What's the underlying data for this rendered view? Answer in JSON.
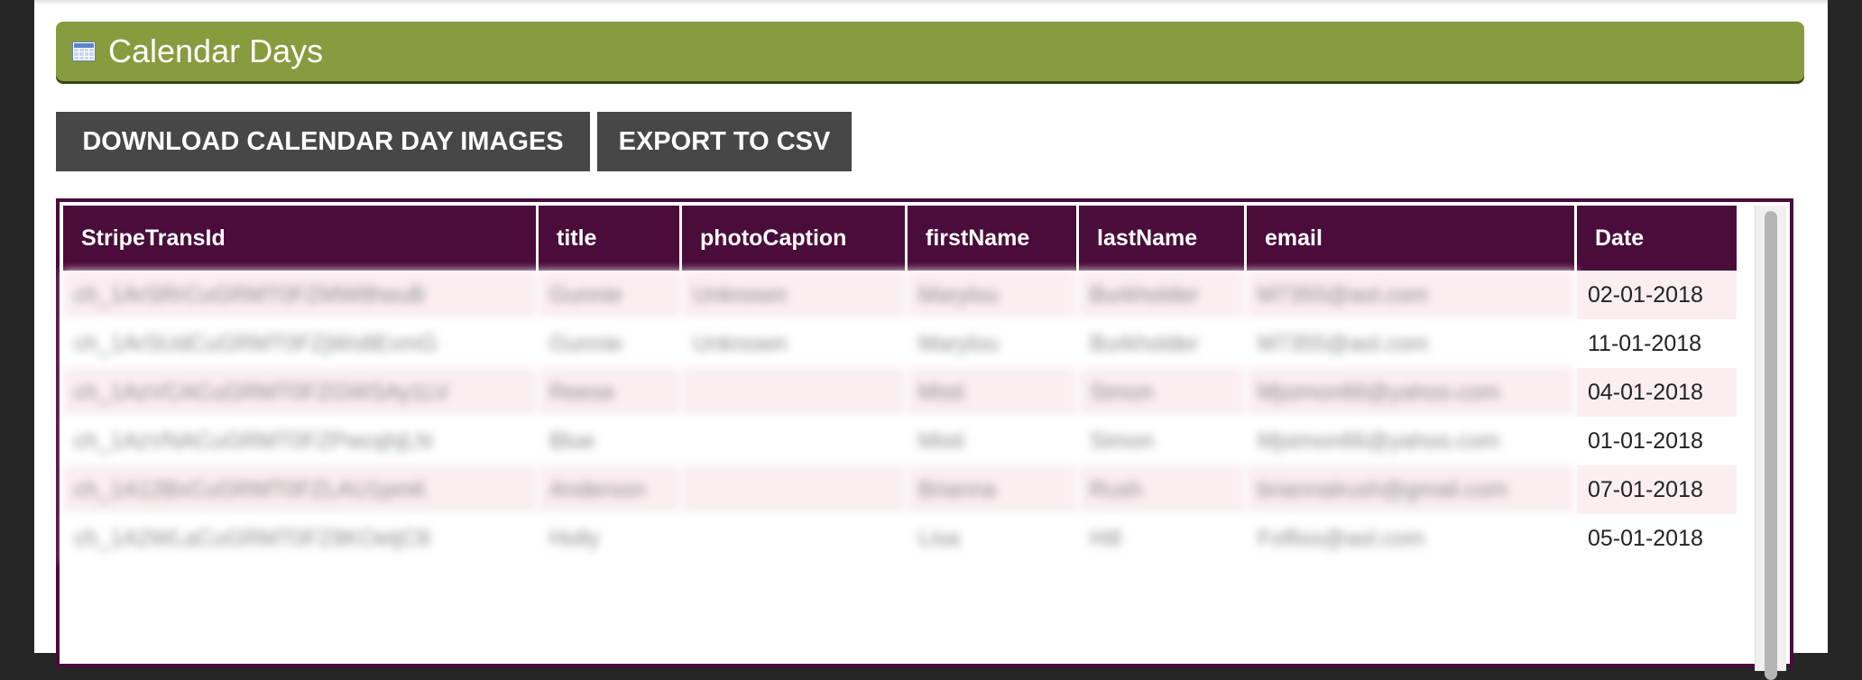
{
  "panel": {
    "title": "Calendar Days",
    "icon": "calendar-icon"
  },
  "toolbar": {
    "download_label": "DOWNLOAD CALENDAR DAY IMAGES",
    "export_label": "EXPORT TO CSV"
  },
  "table": {
    "columns": [
      "StripeTransId",
      "title",
      "photoCaption",
      "firstName",
      "lastName",
      "email",
      "Date"
    ],
    "rows": [
      [
        "ch_1ArSRrCuGRMT0FZMW8heuB",
        "Gunnie",
        "Unknown",
        "Marylou",
        "Burkholder",
        "M7355@aol.com",
        "02-01-2018"
      ],
      [
        "ch_1ArSUdCuGRMT0FZjWs8EvmG",
        "Gunnie",
        "Unknown",
        "Marylou",
        "Burkholder",
        "M7355@aol.com",
        "11-01-2018"
      ],
      [
        "ch_1AzVCACuGRMT0FZGWSAy1LV",
        "Reese",
        "",
        "Misti",
        "Simon",
        "Mjsimon66@yahoo.com",
        "04-01-2018"
      ],
      [
        "ch_1AzVNACuGRMT0FZPwcqhjLN",
        "Blue",
        "",
        "Misti",
        "Simon",
        "Mjsimon66@yahoo.com",
        "01-01-2018"
      ],
      [
        "ch_1A12BxCuGRMT0FZLAU1pmK",
        "Anderson",
        "",
        "Brianna",
        "Rush",
        "briannalrush@gmail.com",
        "07-01-2018"
      ],
      [
        "ch_1A2WLaCuGRMT0FZ8KOetjC8",
        "Holly",
        "",
        "Lisa",
        "Hill",
        "Fofliss@aol.com",
        "05-01-2018"
      ]
    ]
  },
  "colors": {
    "title_bar": "#879c3e",
    "header": "#4a0c3a",
    "button": "#474747",
    "row_alt": "#faeef1"
  }
}
